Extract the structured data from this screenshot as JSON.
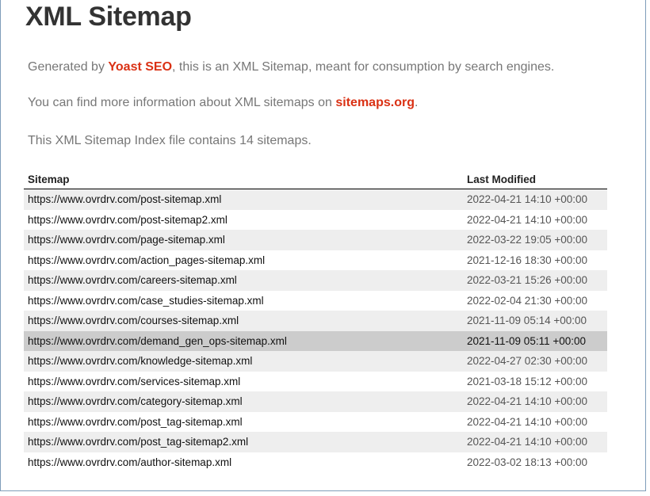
{
  "page": {
    "title": "XML Sitemap",
    "intro_prefix": "Generated by ",
    "intro_link": "Yoast SEO",
    "intro_suffix": ", this is an XML Sitemap, meant for consumption by search engines.",
    "info_prefix": "You can find more information about XML sitemaps on ",
    "info_link": "sitemaps.org",
    "info_suffix": ".",
    "count_text": "This XML Sitemap Index file contains 14 sitemaps."
  },
  "table": {
    "headers": {
      "sitemap": "Sitemap",
      "last_modified": "Last Modified"
    },
    "rows": [
      {
        "url": "https://www.ovrdrv.com/post-sitemap.xml",
        "modified": "2022-04-21 14:10 +00:00"
      },
      {
        "url": "https://www.ovrdrv.com/post-sitemap2.xml",
        "modified": "2022-04-21 14:10 +00:00"
      },
      {
        "url": "https://www.ovrdrv.com/page-sitemap.xml",
        "modified": "2022-03-22 19:05 +00:00"
      },
      {
        "url": "https://www.ovrdrv.com/action_pages-sitemap.xml",
        "modified": "2021-12-16 18:30 +00:00"
      },
      {
        "url": "https://www.ovrdrv.com/careers-sitemap.xml",
        "modified": "2022-03-21 15:26 +00:00"
      },
      {
        "url": "https://www.ovrdrv.com/case_studies-sitemap.xml",
        "modified": "2022-02-04 21:30 +00:00"
      },
      {
        "url": "https://www.ovrdrv.com/courses-sitemap.xml",
        "modified": "2021-11-09 05:14 +00:00"
      },
      {
        "url": "https://www.ovrdrv.com/demand_gen_ops-sitemap.xml",
        "modified": "2021-11-09 05:11 +00:00"
      },
      {
        "url": "https://www.ovrdrv.com/knowledge-sitemap.xml",
        "modified": "2022-04-27 02:30 +00:00"
      },
      {
        "url": "https://www.ovrdrv.com/services-sitemap.xml",
        "modified": "2021-03-18 15:12 +00:00"
      },
      {
        "url": "https://www.ovrdrv.com/category-sitemap.xml",
        "modified": "2022-04-21 14:10 +00:00"
      },
      {
        "url": "https://www.ovrdrv.com/post_tag-sitemap.xml",
        "modified": "2022-04-21 14:10 +00:00"
      },
      {
        "url": "https://www.ovrdrv.com/post_tag-sitemap2.xml",
        "modified": "2022-04-21 14:10 +00:00"
      },
      {
        "url": "https://www.ovrdrv.com/author-sitemap.xml",
        "modified": "2022-03-02 18:13 +00:00"
      }
    ],
    "hovered_row": 7
  },
  "colors": {
    "link_accent": "#da3114",
    "row_alt": "#eeeeee",
    "row_hover": "#cccccc"
  }
}
